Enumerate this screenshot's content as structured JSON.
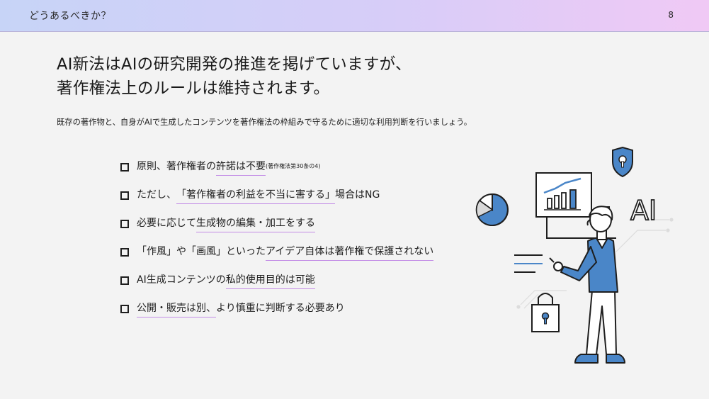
{
  "header": {
    "title": "どうあるべきか？",
    "page_number": "8"
  },
  "headline": {
    "line1": "AI新法はAIの研究開発の推進を掲げていますが、",
    "line2": "著作権法上のルールは維持されます。"
  },
  "subtext": "既存の著作物と、自身がAIで生成したコンテンツを著作権法の枠組みで守るために適切な利用判断を行いましょう。",
  "bullets": [
    {
      "pre": "原則、著作権者の",
      "hl": "許諾は不要",
      "post": "",
      "note": "(著作権法第30条の4)"
    },
    {
      "pre": "ただし、",
      "hl": "「著作権者の利益を不当に害する」",
      "post": "場合はNG"
    },
    {
      "pre": "必要に応じて",
      "hl": "生成物の編集・加工をする",
      "post": ""
    },
    {
      "pre": "「作風」や「画風」といった",
      "hl": "アイデア自体は著作権で保護されない",
      "post": ""
    },
    {
      "pre": "AI生成コンテンツの",
      "hl": "私的使用目的は可能",
      "post": ""
    },
    {
      "pre": "",
      "hl": "公開・販売は別、",
      "post": "より慎重に判断する必要あり"
    }
  ],
  "illustration": {
    "ai_label": "AI",
    "accent_color": "#4a86c8",
    "accent_light": "#a9c9ea"
  }
}
